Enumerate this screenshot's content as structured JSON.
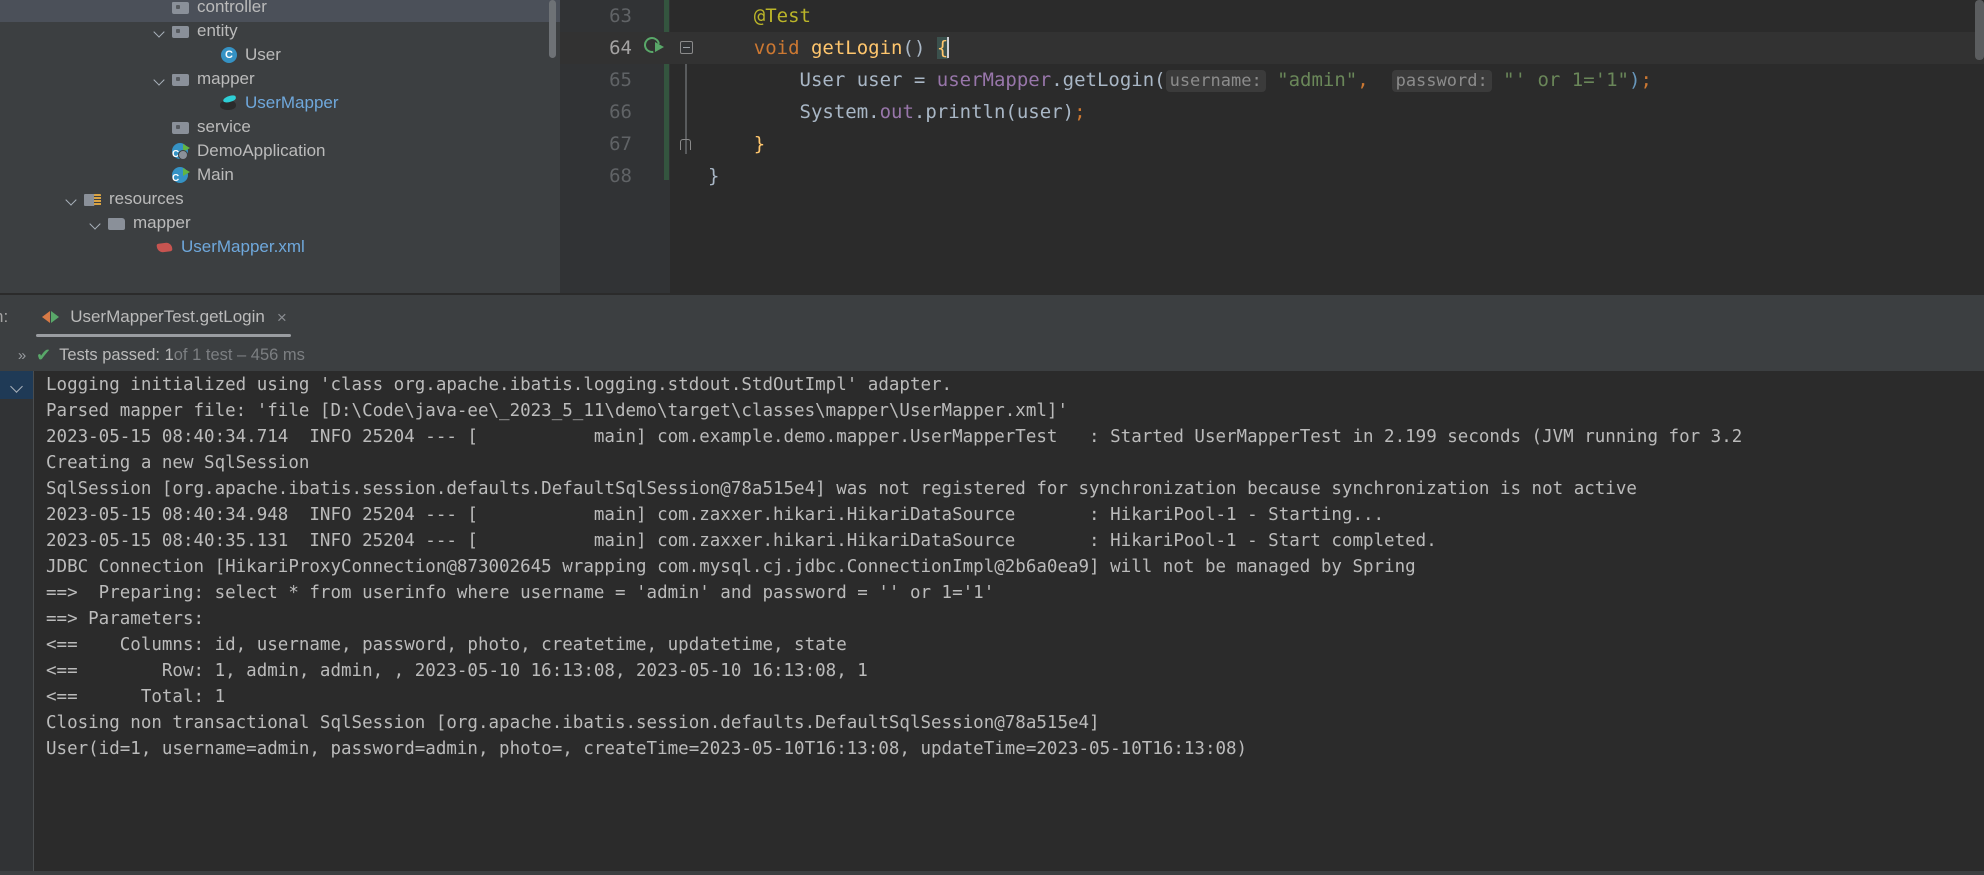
{
  "project_tree": {
    "items": [
      {
        "label": "controller",
        "icon": "folder-icon",
        "indent": 152,
        "arrow": "none",
        "style": "plain",
        "clipped_top": true
      },
      {
        "label": "entity",
        "icon": "folder-icon",
        "indent": 152,
        "arrow": "open",
        "style": "plain"
      },
      {
        "label": "User",
        "icon": "java-class-icon",
        "indent": 200,
        "arrow": "none",
        "style": "plain"
      },
      {
        "label": "mapper",
        "icon": "folder-icon",
        "indent": 152,
        "arrow": "open",
        "style": "plain"
      },
      {
        "label": "UserMapper",
        "icon": "mybatis-mapper-icon",
        "indent": 200,
        "arrow": "none",
        "style": "blue"
      },
      {
        "label": "service",
        "icon": "folder-icon",
        "indent": 152,
        "arrow": "none",
        "style": "plain"
      },
      {
        "label": "DemoApplication",
        "icon": "spring-boot-class-icon",
        "indent": 152,
        "arrow": "none",
        "style": "plain"
      },
      {
        "label": "Main",
        "icon": "runnable-class-icon",
        "indent": 152,
        "arrow": "none",
        "style": "plain"
      },
      {
        "label": "resources",
        "icon": "resources-folder-icon",
        "indent": 64,
        "arrow": "open",
        "style": "plain"
      },
      {
        "label": "mapper",
        "icon": "plain-folder-icon",
        "indent": 88,
        "arrow": "open",
        "style": "plain"
      },
      {
        "label": "UserMapper.xml",
        "icon": "xml-file-icon",
        "indent": 136,
        "arrow": "none",
        "style": "blue",
        "clipped_bottom": true
      }
    ]
  },
  "editor": {
    "lines": [
      {
        "number": "63",
        "active": false,
        "tokens": [
          {
            "text": "    ",
            "cls": "k-plain"
          },
          {
            "text": "@Test",
            "cls": "k-ann"
          }
        ]
      },
      {
        "number": "64",
        "active": true,
        "run_icon": true,
        "fold": "open",
        "tokens": [
          {
            "text": "    ",
            "cls": "k-plain"
          },
          {
            "text": "void",
            "cls": "k-kw"
          },
          {
            "text": " ",
            "cls": "k-plain"
          },
          {
            "text": "getLogin",
            "cls": "k-meth"
          },
          {
            "text": "() ",
            "cls": "k-plain"
          },
          {
            "text": "{",
            "cls": "k-brace brace-hl"
          },
          {
            "text": "CURSOR",
            "cls": "cursor"
          }
        ]
      },
      {
        "number": "65",
        "active": false,
        "tokens": [
          {
            "text": "        ",
            "cls": "k-plain"
          },
          {
            "text": "User user = ",
            "cls": "k-plain"
          },
          {
            "text": "userMapper",
            "cls": "k-field"
          },
          {
            "text": ".getLogin(",
            "cls": "k-plain"
          },
          {
            "text": "username:",
            "cls": "k-hint"
          },
          {
            "text": " ",
            "cls": "k-plain"
          },
          {
            "text": "\"admin\"",
            "cls": "k-str"
          },
          {
            "text": ",",
            "cls": "k-kw"
          },
          {
            "text": "  ",
            "cls": "k-plain"
          },
          {
            "text": "password:",
            "cls": "k-hint"
          },
          {
            "text": " ",
            "cls": "k-plain"
          },
          {
            "text": "\"' or 1='1\"",
            "cls": "k-str"
          },
          {
            "text": ")",
            "cls": "k-num"
          },
          {
            "text": ";",
            "cls": "k-kw"
          }
        ]
      },
      {
        "number": "66",
        "active": false,
        "tokens": [
          {
            "text": "        ",
            "cls": "k-plain"
          },
          {
            "text": "System.",
            "cls": "k-plain"
          },
          {
            "text": "out",
            "cls": "k-field"
          },
          {
            "text": ".println(user)",
            "cls": "k-plain"
          },
          {
            "text": ";",
            "cls": "k-kw"
          }
        ]
      },
      {
        "number": "67",
        "active": false,
        "fold": "end",
        "tokens": [
          {
            "text": "    ",
            "cls": "k-plain"
          },
          {
            "text": "}",
            "cls": "k-brace"
          }
        ]
      },
      {
        "number": "68",
        "active": false,
        "tokens": [
          {
            "text": "",
            "cls": "k-plain"
          },
          {
            "text": "}",
            "cls": "k-plain"
          }
        ]
      }
    ]
  },
  "run_window": {
    "tool_label": "n:",
    "tab": {
      "title": "UserMapperTest.getLogin",
      "close_glyph": "×",
      "icon": "run-configuration-icon"
    },
    "status": {
      "expand_glyph": "»",
      "check_glyph": "✔",
      "passed_text": "Tests passed: 1",
      "detail_text": " of 1 test – 456 ms"
    },
    "console_lines": [
      "Logging initialized using 'class org.apache.ibatis.logging.stdout.StdOutImpl' adapter.",
      "Parsed mapper file: 'file [D:\\Code\\java-ee\\_2023_5_11\\demo\\target\\classes\\mapper\\UserMapper.xml]'",
      "2023-05-15 08:40:34.714  INFO 25204 --- [           main] com.example.demo.mapper.UserMapperTest   : Started UserMapperTest in 2.199 seconds (JVM running for 3.2",
      "Creating a new SqlSession",
      "SqlSession [org.apache.ibatis.session.defaults.DefaultSqlSession@78a515e4] was not registered for synchronization because synchronization is not active",
      "2023-05-15 08:40:34.948  INFO 25204 --- [           main] com.zaxxer.hikari.HikariDataSource       : HikariPool-1 - Starting...",
      "2023-05-15 08:40:35.131  INFO 25204 --- [           main] com.zaxxer.hikari.HikariDataSource       : HikariPool-1 - Start completed.",
      "JDBC Connection [HikariProxyConnection@873002645 wrapping com.mysql.cj.jdbc.ConnectionImpl@2b6a0ea9] will not be managed by Spring",
      "==>  Preparing: select * from userinfo where username = 'admin' and password = '' or 1='1'",
      "==> Parameters: ",
      "<==    Columns: id, username, password, photo, createtime, updatetime, state",
      "<==        Row: 1, admin, admin, , 2023-05-10 16:13:08, 2023-05-10 16:13:08, 1",
      "<==      Total: 1",
      "Closing non transactional SqlSession [org.apache.ibatis.session.defaults.DefaultSqlSession@78a515e4]",
      "User(id=1, username=admin, password=admin, photo=, createTime=2023-05-10T16:13:08, updateTime=2023-05-10T16:13:08)"
    ]
  },
  "colors": {
    "panel_bg": "#3c3f41",
    "editor_bg": "#2b2b2b",
    "gutter_bg": "#313335",
    "text": "#bbbbbb",
    "accent_green": "#59a869",
    "accent_blue": "#6fa8dc",
    "string_green": "#6a8759",
    "keyword_orange": "#cc7832",
    "method_yellow": "#ffc66d",
    "field_purple": "#9876aa",
    "annotation_olive": "#bbb529"
  }
}
